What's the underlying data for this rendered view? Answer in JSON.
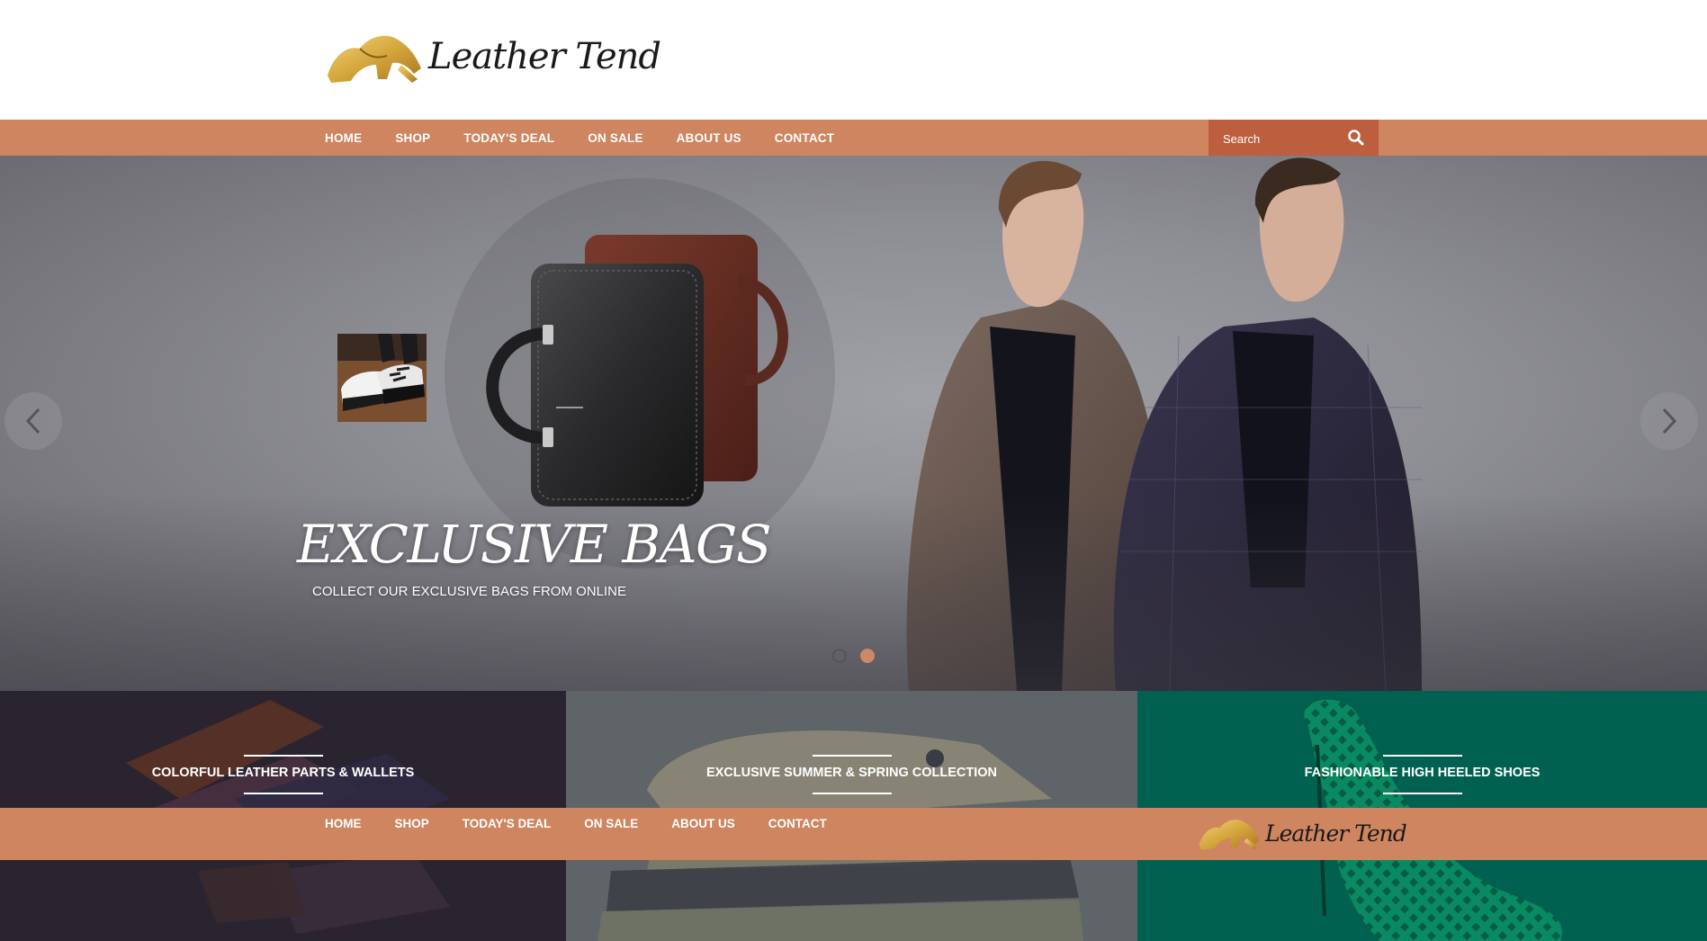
{
  "brand": {
    "name": "Leather Tend"
  },
  "nav": {
    "items": [
      "HOME",
      "SHOP",
      "TODAY'S DEAL",
      "ON SALE",
      "ABOUT US",
      "CONTACT"
    ]
  },
  "search": {
    "placeholder": "Search"
  },
  "hero": {
    "title": "EXCLUSIVE BAGS",
    "subtitle": "COLLECT OUR EXCLUSIVE BAGS FROM ONLINE",
    "slide_count": 2,
    "active_slide": 2
  },
  "categories": [
    {
      "caption": "COLORFUL LEATHER PARTS &  WALLETS",
      "bg": "#2a2431"
    },
    {
      "caption": "EXCLUSIVE SUMMER & SPRING COLLECTION",
      "bg": "#5f6468"
    },
    {
      "caption": "FASHIONABLE HIGH HEELED SHOES",
      "bg": "#016150"
    }
  ],
  "footer": {
    "nav": [
      "HOME",
      "SHOP",
      "TODAY'S DEAL",
      "ON SALE",
      "ABOUT US",
      "CONTACT"
    ]
  },
  "colors": {
    "accent": "#cf8560",
    "search_bg": "#bd5f3e",
    "logo_gold": "#d4a63c"
  }
}
